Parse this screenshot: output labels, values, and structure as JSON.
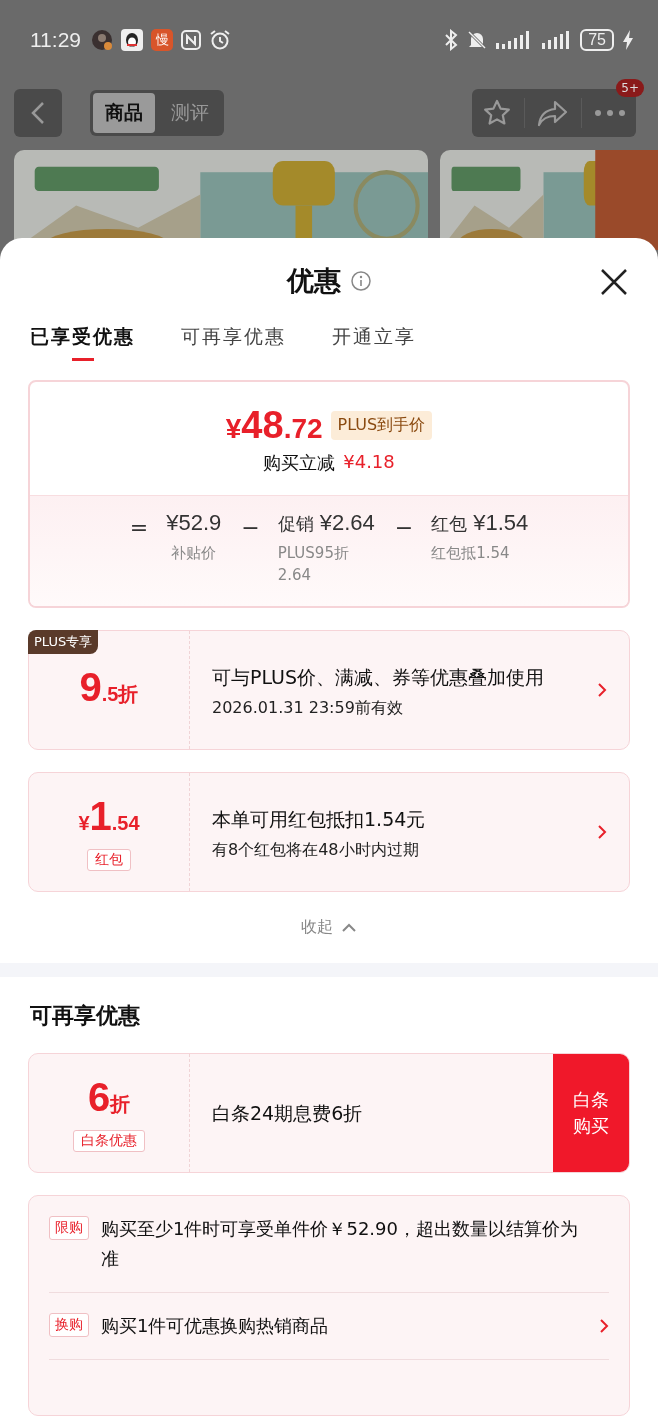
{
  "status_bar": {
    "time": "11:29",
    "app_label": "慢",
    "battery": "75"
  },
  "nav": {
    "tabs": [
      {
        "label": "商品",
        "selected": true
      },
      {
        "label": "测评",
        "selected": false
      }
    ],
    "badge": "5+"
  },
  "sheet": {
    "title": "优惠",
    "tabs": [
      {
        "label": "已享受优惠",
        "selected": true
      },
      {
        "label": "可再享优惠",
        "selected": false
      },
      {
        "label": "开通立享",
        "selected": false
      }
    ],
    "summary": {
      "currency": "¥",
      "price_int": "48",
      "price_dec": ".72",
      "price_tag": "PLUS到手价",
      "saving_label": "购买立减",
      "saving": "¥4.18",
      "breakdown": [
        {
          "op": "=",
          "amount": "¥52.9",
          "note": "补贴价"
        },
        {
          "op": "−",
          "label": "促销",
          "amount": "¥2.64",
          "note": "PLUS95折 2.64"
        },
        {
          "op": "−",
          "label": "红包",
          "amount": "¥1.54",
          "note": "红包抵1.54"
        }
      ]
    },
    "coupons": [
      {
        "corner": "PLUS专享",
        "big": "9",
        "small": ".5折",
        "title": "可与PLUS价、满减、券等优惠叠加使用",
        "subtitle": "2026.01.31  23:59前有效"
      },
      {
        "prefix": "¥",
        "big": "1",
        "small": ".54",
        "label": "红包",
        "title": "本单可用红包抵扣1.54元",
        "subtitle": "有8个红包将在48小时内过期"
      }
    ],
    "collapse": "收起",
    "more_title": "可再享优惠",
    "more_coupon": {
      "big": "6",
      "small": "折",
      "label": "白条优惠",
      "title": "白条24期息费6折",
      "action": "白条购买"
    },
    "rules": [
      {
        "tag": "限购",
        "text": "购买至少1件时可享受单件价￥52.90，超出数量以结算价为准",
        "arrow": false
      },
      {
        "tag": "换购",
        "text": "购买1件可优惠换购热销商品",
        "arrow": true
      }
    ]
  }
}
